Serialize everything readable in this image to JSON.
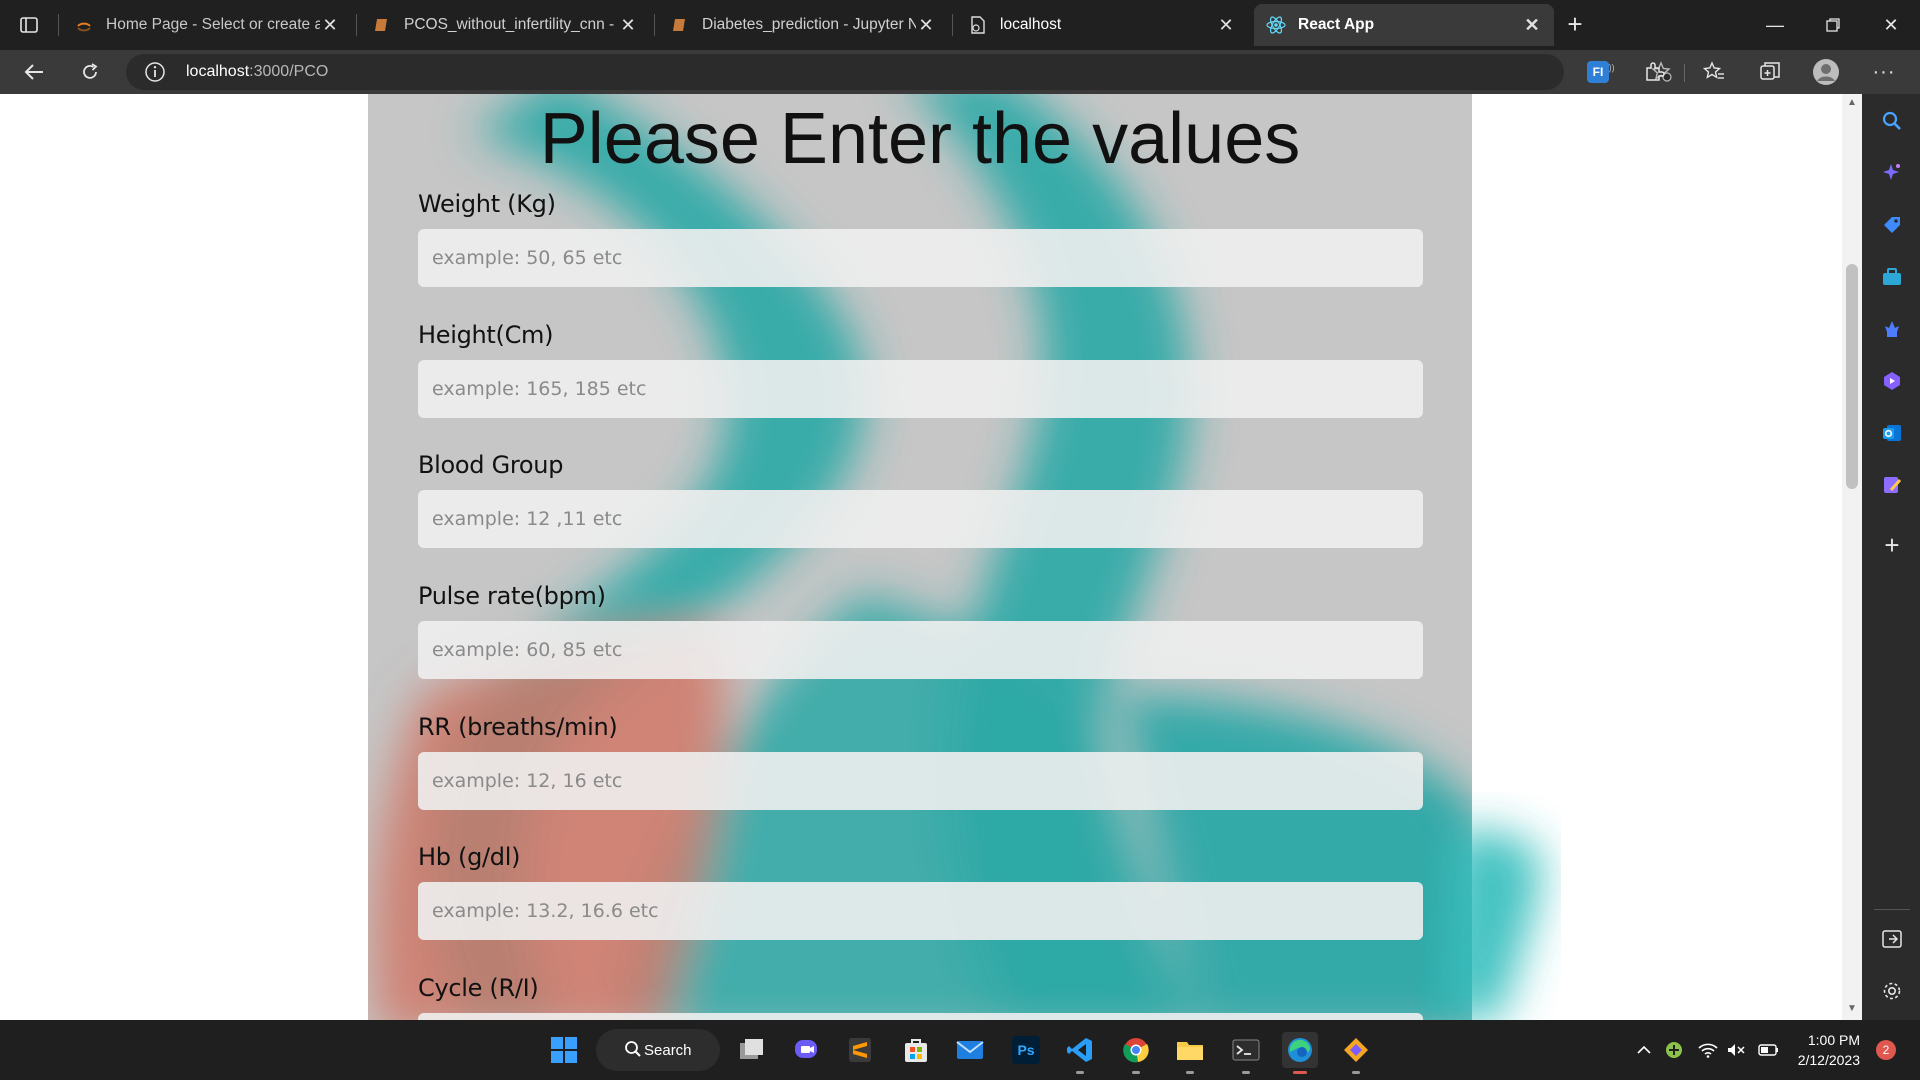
{
  "browser": {
    "tabs": [
      {
        "title": "Home Page - Select or create a n",
        "icon": "jupyter-icon"
      },
      {
        "title": "PCOS_without_infertility_cnn - Ju",
        "icon": "notebook-icon"
      },
      {
        "title": "Diabetes_prediction - Jupyter No",
        "icon": "notebook-icon"
      },
      {
        "title": "localhost",
        "icon": "page-icon"
      },
      {
        "title": "React App",
        "icon": "react-icon",
        "active": true
      }
    ],
    "url_host": "localhost",
    "url_path": ":3000/PCO"
  },
  "form": {
    "title": "Please Enter the values",
    "fields": [
      {
        "label": "Weight (Kg)",
        "placeholder": "example: 50, 65 etc"
      },
      {
        "label": "Height(Cm)",
        "placeholder": "example: 165, 185 etc"
      },
      {
        "label": "Blood Group",
        "placeholder": "example: 12 ,11 etc"
      },
      {
        "label": "Pulse rate(bpm)",
        "placeholder": "example: 60, 85 etc"
      },
      {
        "label": "RR (breaths/min)",
        "placeholder": "example: 12, 16 etc"
      },
      {
        "label": "Hb (g/dl)",
        "placeholder": "example: 13.2, 16.6 etc"
      },
      {
        "label": "Cycle (R/I)",
        "placeholder": ""
      }
    ]
  },
  "taskbar": {
    "search_label": "Search",
    "time": "1:00 PM",
    "date": "2/12/2023",
    "notifications": "2"
  },
  "colors": {
    "accent_teal": "#2aa8a6",
    "accent_salmon": "#d07868",
    "card_gray": "#c6c6c6"
  }
}
